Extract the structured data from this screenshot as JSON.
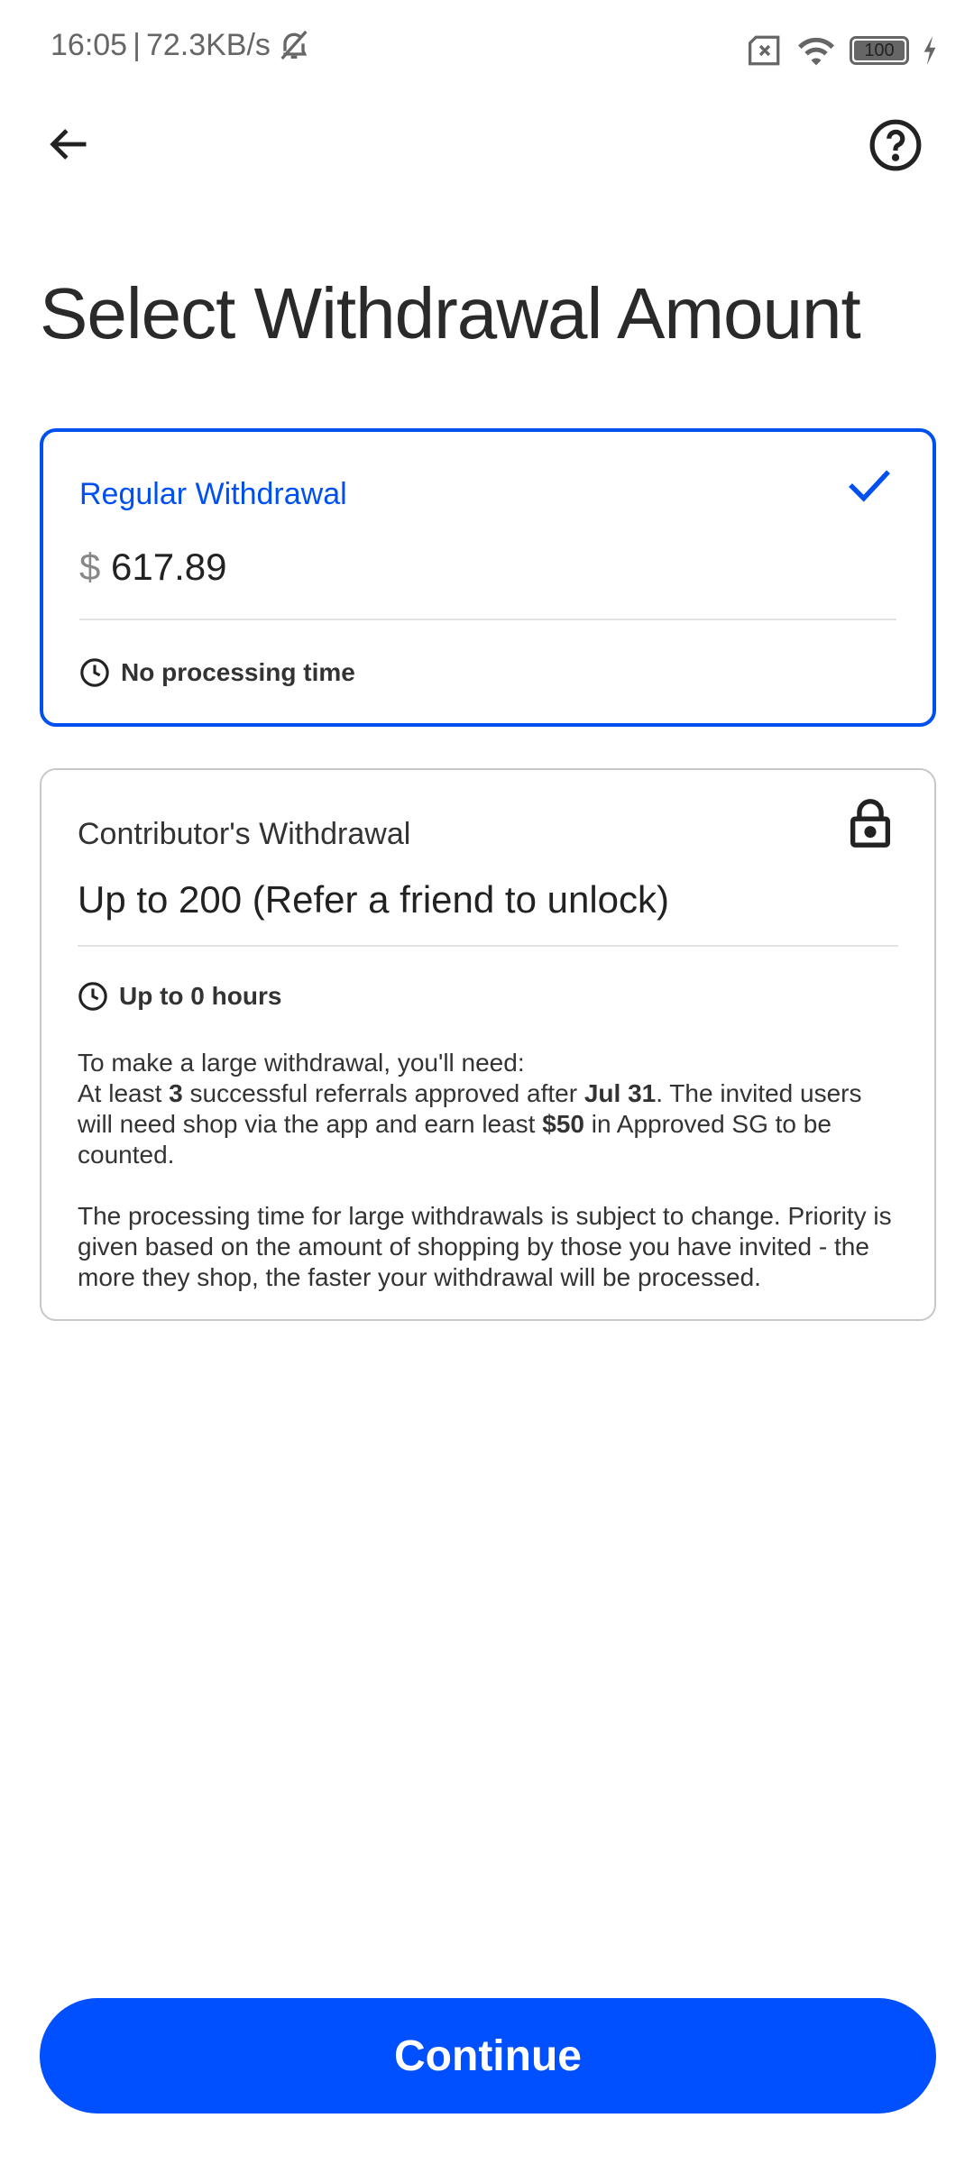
{
  "status_bar": {
    "time": "16:05",
    "speed": "72.3KB/s",
    "battery": "100"
  },
  "header": {
    "title": "Select Withdrawal Amount"
  },
  "regular": {
    "label": "Regular Withdrawal",
    "currency": "$",
    "amount": "617.89",
    "processing": "No processing time"
  },
  "contributor": {
    "label": "Contributor's Withdrawal",
    "amount": "Up to 200 (Refer a friend to unlock)",
    "processing": "Up to 0 hours",
    "intro": "To make a large withdrawal, you'll need:",
    "req_a": "At least ",
    "req_count": "3",
    "req_b": " successful referrals approved after ",
    "req_date": "Jul 31",
    "req_c": ". The invited users will need shop via the app and earn least ",
    "req_amount": "$50",
    "req_d": " in Approved SG to be counted.",
    "note": "The processing time for large withdrawals is subject to change. Priority is given based on the amount of shopping by those you have invited - the more they shop, the faster your withdrawal will be processed."
  },
  "continue_label": "Continue",
  "colors": {
    "accent": "#0050ff"
  }
}
